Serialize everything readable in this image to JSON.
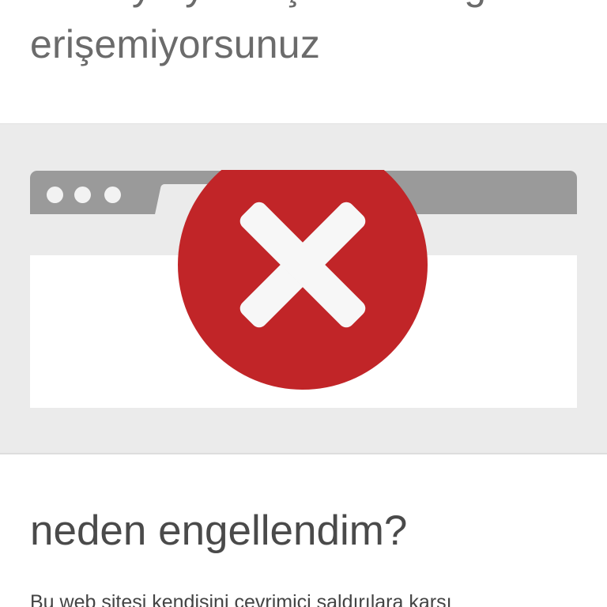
{
  "header": {
    "title_partial_top": "Bu sayfaya erişmeniz engellendi ve",
    "title_line2": "erişemiyorsunuz"
  },
  "illustration": {
    "browser_dots": 3,
    "error_color": "#c12528",
    "browser_bar_color": "#9a9a9a"
  },
  "explanation": {
    "heading": "neden engellendim?",
    "body_partial": "Bu web sitesi kendisini çevrimiçi saldırılara karşı"
  }
}
